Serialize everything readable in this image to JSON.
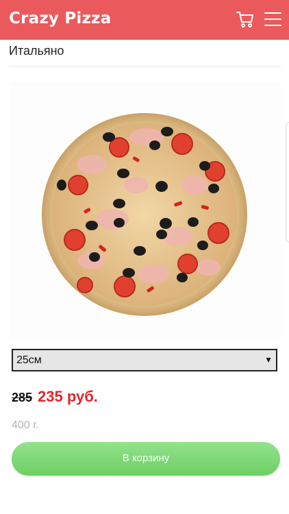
{
  "header": {
    "brand": "Crazy Pizza",
    "cart_icon": "cart-icon",
    "menu_icon": "hamburger-menu-icon",
    "background_color": "#ea5a5c"
  },
  "product": {
    "name": "Итальяно",
    "size_selected": "25см",
    "price_old": "285",
    "price_new": "235 руб.",
    "weight": "400 г.",
    "add_to_cart_label": "В корзину"
  },
  "colors": {
    "price_new": "#e0262a",
    "button": "#7bd872"
  }
}
